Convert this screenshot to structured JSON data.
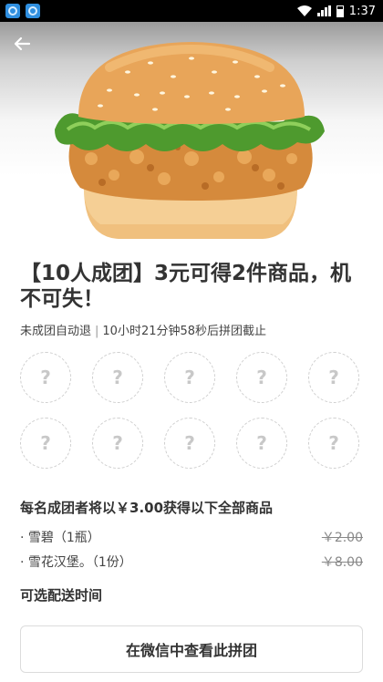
{
  "status_bar": {
    "time": "1:37",
    "app_icons": [
      "app-notification-icon",
      "app-notification-icon"
    ],
    "icons": [
      "wifi-icon",
      "signal-icon",
      "battery-icon"
    ]
  },
  "header": {
    "back_icon": "arrow-left-icon"
  },
  "hero": {
    "image": "fried-chicken-burger"
  },
  "group": {
    "title": "【10人成团】3元可得2件商品，机不可失！",
    "refund_note": "未成团自动退",
    "separator": "|",
    "deadline": "10小时21分钟58秒后拼团截止",
    "slot_placeholder": "?",
    "slot_count": 10
  },
  "items_section": {
    "heading": "每名成团者将以￥3.00获得以下全部商品",
    "items": [
      {
        "name": "· 雪碧（1瓶）",
        "price": "￥2.00"
      },
      {
        "name": "· 雪花汉堡。（1份）",
        "price": "￥8.00"
      }
    ]
  },
  "delivery": {
    "label": "可选配送时间"
  },
  "action": {
    "label": "在微信中查看此拼团"
  },
  "colors": {
    "status_bar": "#000000",
    "text": "#333333",
    "slot_border": "#cfcfcf",
    "bun": "#e8a559",
    "lettuce": "#4e9a2e"
  }
}
